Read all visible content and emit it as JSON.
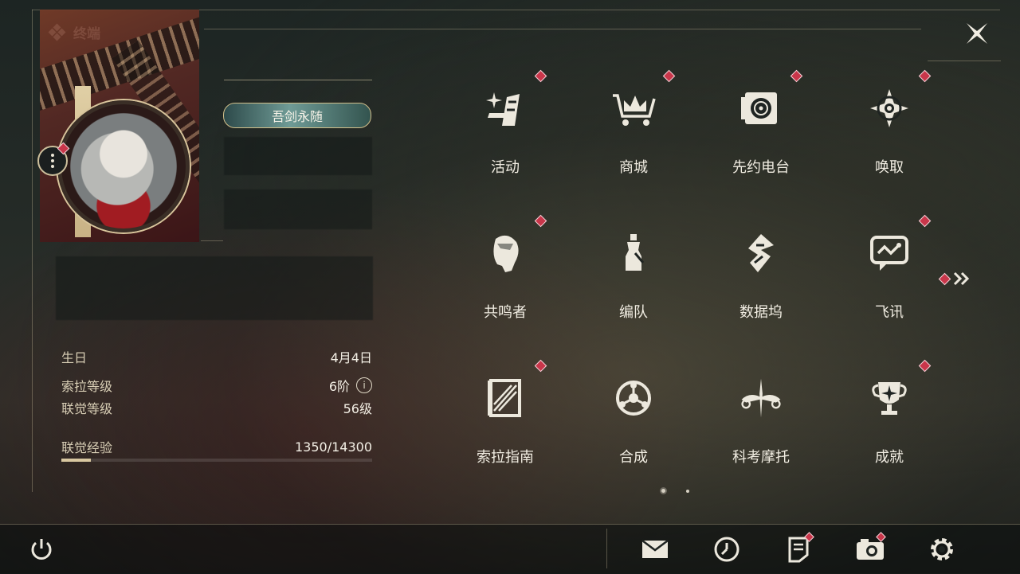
{
  "header": {
    "title": "终端",
    "close_icon": "close-icon"
  },
  "profile": {
    "title_badge": "吾剑永随",
    "info": [
      {
        "key": "生日",
        "value": "4月4日"
      },
      {
        "key": "索拉等级",
        "value": "6阶"
      },
      {
        "key": "联觉等级",
        "value": "56级"
      },
      {
        "key": "联觉经验",
        "value": "1350/14300"
      }
    ],
    "exp_progress": 0.094
  },
  "menu": [
    {
      "label": "活动",
      "icon": "sparkle-icon",
      "badge": true
    },
    {
      "label": "商城",
      "icon": "crown-cart-icon",
      "badge": true
    },
    {
      "label": "先约电台",
      "icon": "radio-icon",
      "badge": true
    },
    {
      "label": "唤取",
      "icon": "compass-star-icon",
      "badge": true
    },
    {
      "label": "共鸣者",
      "icon": "character-head-icon",
      "badge": true
    },
    {
      "label": "编队",
      "icon": "chess-pieces-icon",
      "badge": false
    },
    {
      "label": "数据坞",
      "icon": "data-dock-icon",
      "badge": false
    },
    {
      "label": "飞讯",
      "icon": "chat-bubble-icon",
      "badge": true
    },
    {
      "label": "索拉指南",
      "icon": "guide-book-icon",
      "badge": true
    },
    {
      "label": "合成",
      "icon": "synthesis-icon",
      "badge": false
    },
    {
      "label": "科考摩托",
      "icon": "motorcycle-icon",
      "badge": false
    },
    {
      "label": "成就",
      "icon": "trophy-icon",
      "badge": true
    }
  ],
  "bottom": {
    "power": "power-icon",
    "mail": "mail-icon",
    "clock": "clock-icon",
    "notes": "notes-icon",
    "camera": "camera-icon",
    "settings": "gear-icon"
  },
  "colors": {
    "accent": "#d8c7a0",
    "badge": "#c9364a"
  }
}
